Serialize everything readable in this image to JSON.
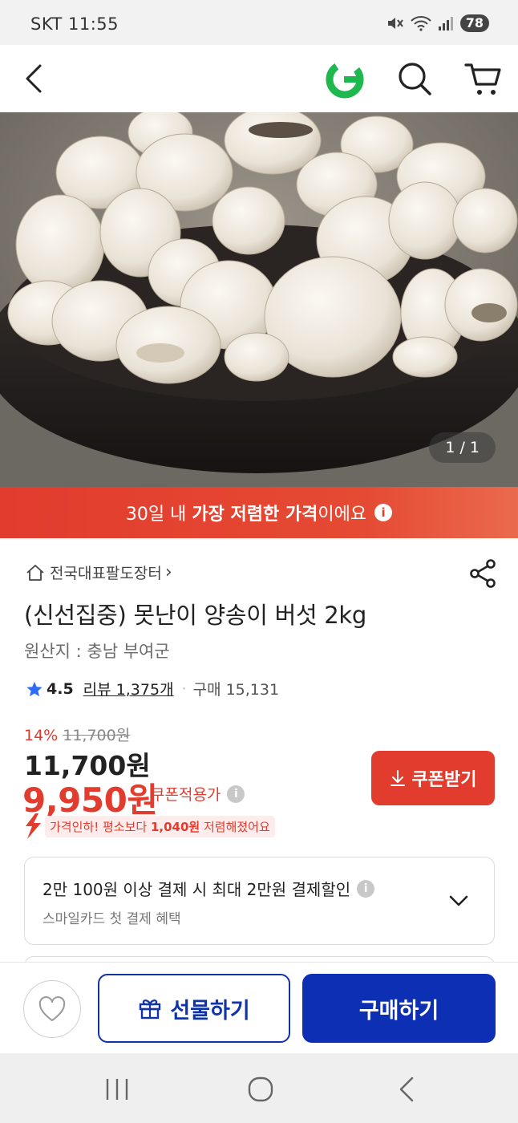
{
  "status_bar": {
    "carrier_time": "SKT 11:55",
    "battery": "78"
  },
  "header": {
    "back_icon": "chevron-left-icon",
    "logo_letter": "G",
    "logo_colors": [
      "#1fb84f",
      "#3fcf5a"
    ],
    "search_icon": "search-icon",
    "cart_icon": "cart-icon"
  },
  "gallery": {
    "pager": "1 / 1"
  },
  "banner": {
    "prefix": "30일 내 ",
    "bold": "가장 저렴한 가격",
    "suffix": "이에요",
    "info": "i",
    "color": "#e23c2e"
  },
  "product": {
    "seller": "전국대표팔도장터",
    "seller_arrow": "›",
    "title": "(신선집중) 못난이 양송이 버섯 2kg",
    "origin": "원산지 : 충남 부여군",
    "rating": "4.5",
    "reviews": "리뷰 1,375개",
    "separator": "·",
    "purchases": "구매 15,131"
  },
  "price": {
    "discount_pct": "14%",
    "original": "11,700원",
    "list_price": "11,700원",
    "sale_price": "9,950원",
    "coupon_applied": "쿠폰적용가",
    "info": "i",
    "coupon_button": "쿠폰받기",
    "drop_prefix": "가격인하! 평소보다 ",
    "drop_amount": "1,040원",
    "drop_suffix": " 저렴해졌어요",
    "accent": "#e23c2e"
  },
  "card_benefit": {
    "line1": "2만 100원 이상 결제 시 최대 2만원 결제할인",
    "info": "i",
    "line2": "스마일카드 첫 결제 혜택"
  },
  "actions": {
    "wish_icon": "heart-icon",
    "gift": "선물하기",
    "buy": "구매하기",
    "brand_blue": "#0d2fb3"
  },
  "system_nav": {
    "recents_icon": "recents-icon",
    "home_icon": "home-icon",
    "back_icon": "back-icon"
  }
}
